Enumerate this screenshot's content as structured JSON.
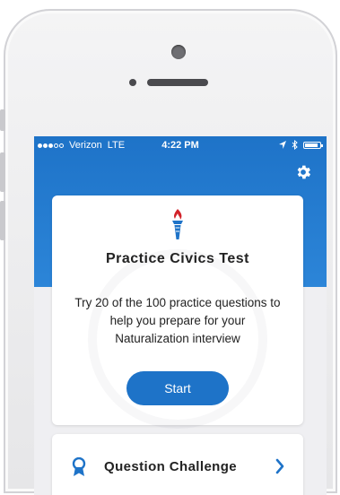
{
  "status_bar": {
    "carrier": "Verizon",
    "network": "LTE",
    "time": "4:22 PM",
    "battery_level": 0.9
  },
  "header": {
    "settings_icon": "gear-icon"
  },
  "main_card": {
    "icon": "torch-icon",
    "title": "Practice Civics Test",
    "description": "Try 20 of the 100 practice questions to help you prepare for your Naturalization interview",
    "start_label": "Start"
  },
  "challenge_card": {
    "icon": "ribbon-icon",
    "label": "Question Challenge",
    "chevron_icon": "chevron-right-icon"
  },
  "colors": {
    "primary": "#1e73c8",
    "torch_red": "#d2232a",
    "torch_blue": "#1e73c8",
    "screen_bg": "#efeff2"
  }
}
